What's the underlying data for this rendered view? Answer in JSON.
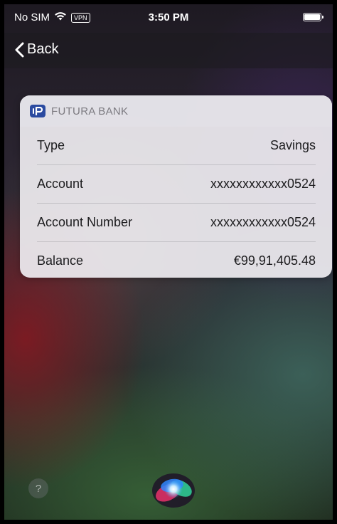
{
  "status_bar": {
    "carrier": "No SIM",
    "vpn_label": "VPN",
    "time": "3:50 PM",
    "battery_level": 1.0
  },
  "navigation": {
    "back_label": "Back"
  },
  "card": {
    "bank_name": "FUTURA BANK",
    "rows": [
      {
        "label": "Type",
        "value": "Savings"
      },
      {
        "label": "Account",
        "value": "xxxxxxxxxxxx0524"
      },
      {
        "label": "Account Number",
        "value": "xxxxxxxxxxxx0524"
      },
      {
        "label": "Balance",
        "value": "€99,91,405.48"
      }
    ]
  },
  "help": {
    "label": "?"
  },
  "icons": {
    "wifi": "wifi-icon",
    "battery": "battery-icon",
    "back": "chevron-left-icon",
    "bank": "bank-logo-icon",
    "siri": "siri-orb-icon"
  },
  "colors": {
    "bank_logo": "#2a4aa0",
    "card_background": "#eeecf0",
    "header_text": "#7c7a80"
  }
}
